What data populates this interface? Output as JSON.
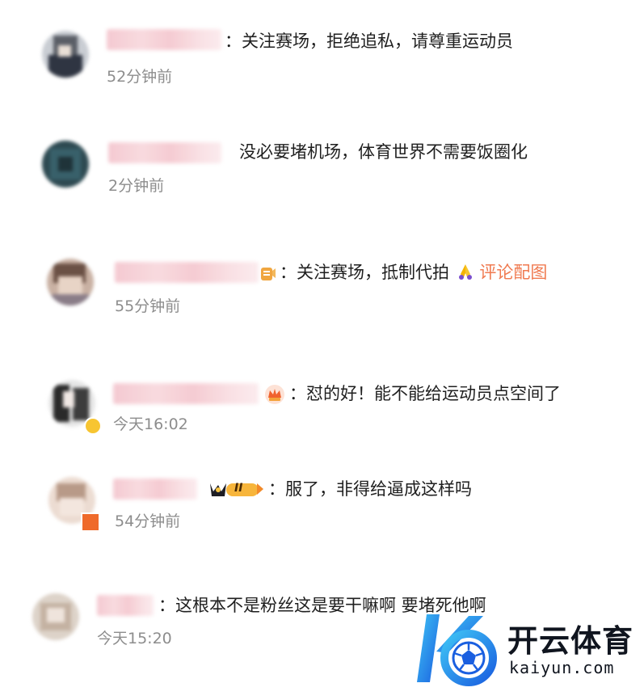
{
  "comments": [
    {
      "text": "：关注赛场，拒绝追私，请尊重运动员",
      "time": "52分钟前"
    },
    {
      "text": "没必要堵机场，体育世界不需要饭圈化",
      "time": "2分钟前"
    },
    {
      "text": "：关注赛场，抵制代拍",
      "emoji": "pray-emoji",
      "link": "评论配图",
      "time": "55分钟前"
    },
    {
      "text": "：怼的好！能不能给运动员点空间了",
      "time": "今天16:02"
    },
    {
      "text": "：服了，非得给逼成这样吗",
      "time": "54分钟前"
    },
    {
      "text": "：这根本不是粉丝这是要干嘛啊 要堵死他啊",
      "time": "今天15:20"
    }
  ],
  "watermark": {
    "title": "开云体育",
    "url": "kaiyun.com"
  },
  "colors": {
    "link": "#f07a50",
    "time": "#8d8d8d",
    "name_blur": "#f4c7cf",
    "accent_blue": "#1a6fe0"
  },
  "badges": {
    "level_badge_text": "II"
  }
}
